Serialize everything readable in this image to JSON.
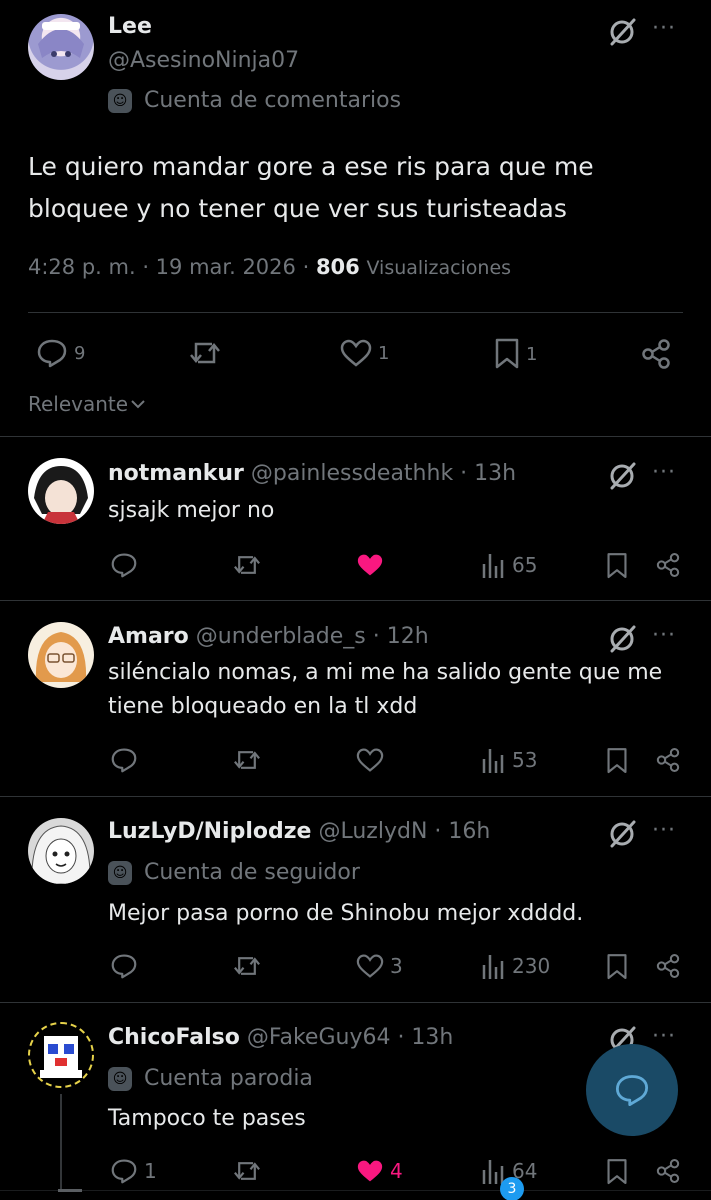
{
  "main_post": {
    "name": "Lee",
    "handle": "@AsesinoNinja07",
    "account_tag": "Cuenta de comentarios",
    "text_line1": "Le quiero mandar gore a ese ris para que me",
    "text_line2": "bloquee y no tener que ver sus turisteadas",
    "time": "4:28 p. m. · 19 mar. 2026 ·",
    "views_count": "806",
    "views_label": "Visualizaciones",
    "replies": "9",
    "likes": "1",
    "bookmarks": "1"
  },
  "sort": {
    "label": "Relevante"
  },
  "replies": [
    {
      "name": "notmankur",
      "handle": "@painlessdeathhk · 13h",
      "text1": "sjsajk mejor no",
      "views": "65",
      "liked": true
    },
    {
      "name": "Amaro",
      "handle": "@underblade_s · 12h",
      "text1": "siléncialo nomas, a mi me ha salido gente que me",
      "text2": "tiene bloqueado en la tl xdd",
      "views": "53"
    },
    {
      "name": "LuzLyD/Niplodze",
      "handle": "@LuzlydN · 16h",
      "account_tag": "Cuenta de seguidor",
      "text1": "Mejor pasa porno de Shinobu mejor xdddd.",
      "likes": "3",
      "views": "230"
    },
    {
      "name": "ChicoFalso",
      "handle": "@FakeGuy64 · 13h",
      "account_tag": "Cuenta parodia",
      "text1": "Tampoco te pases",
      "replies": "1",
      "likes": "4",
      "views": "64",
      "liked": true
    }
  ],
  "more_glyph": "···",
  "mask_glyph": "☺",
  "bottom_nav": {
    "badge": "3"
  },
  "colors": {
    "like": "#f91880",
    "muted": "#71767b",
    "fab": "#1a4a66"
  }
}
